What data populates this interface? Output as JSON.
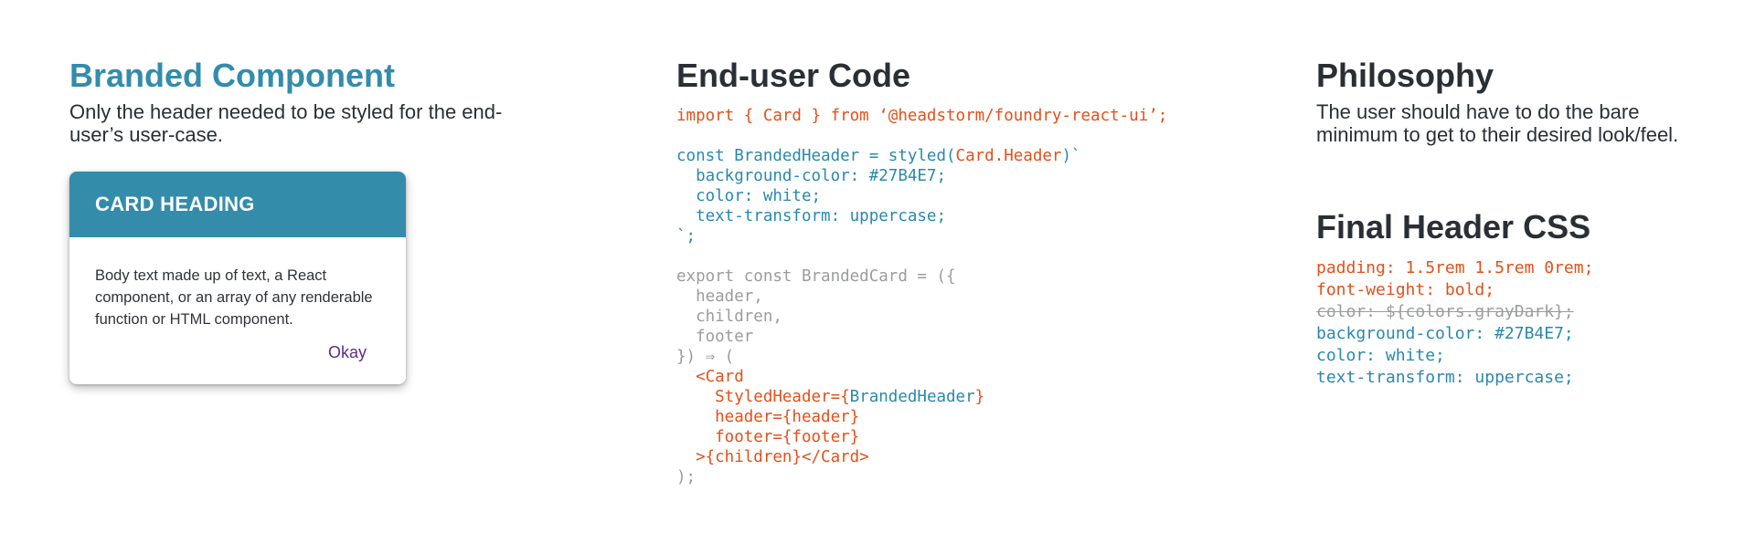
{
  "left": {
    "title": "Branded Component",
    "description": "Only the header needed to be styled for the end-user’s user-case.",
    "card": {
      "heading": "Card Heading",
      "body": "Body text made up of text, a React component, or an array of any renderable function or HTML component.",
      "action_label": "Okay"
    }
  },
  "middle": {
    "title": "End-user Code",
    "code": {
      "import_line": "import { Card } from ‘@headstorm/foundry-react-ui’;",
      "styled_prefix": "const BrandedHeader = styled(",
      "styled_target": "Card.Header",
      "styled_suffix": ")`",
      "style_lines": [
        "  background-color: #27B4E7;",
        "  color: white;",
        "  text-transform: uppercase;",
        "`;"
      ],
      "export_lines": [
        "export const BrandedCard = ({",
        "  header,",
        "  children,",
        "  footer",
        "}) ⇒ ("
      ],
      "card_open": "  <Card",
      "styled_header_prefix": "    StyledHeader={",
      "styled_header_value": "BrandedHeader",
      "styled_header_suffix": "}",
      "prop_lines": [
        "    header={header}",
        "    footer={footer}",
        "  >{children}</Card>"
      ],
      "closing_line": ");"
    }
  },
  "right": {
    "philosophy_title": "Philosophy",
    "philosophy_text": "The user should have to do the bare minimum to get to their desired look/feel.",
    "final_title": "Final Header CSS",
    "css_default_lines": [
      "padding: 1.5rem 1.5rem 0rem;",
      "font-weight: bold;"
    ],
    "css_overridden_line": "color: ${colors.grayDark};",
    "css_custom_lines": [
      "background-color: #27B4E7;",
      "color: white;",
      "text-transform: uppercase;"
    ]
  },
  "colors": {
    "brand_teal": "#338caa",
    "code_red": "#e3501a",
    "code_blue": "#2a88ad",
    "code_gray": "#9a9c9e",
    "okay_purple": "#5b2c86"
  }
}
